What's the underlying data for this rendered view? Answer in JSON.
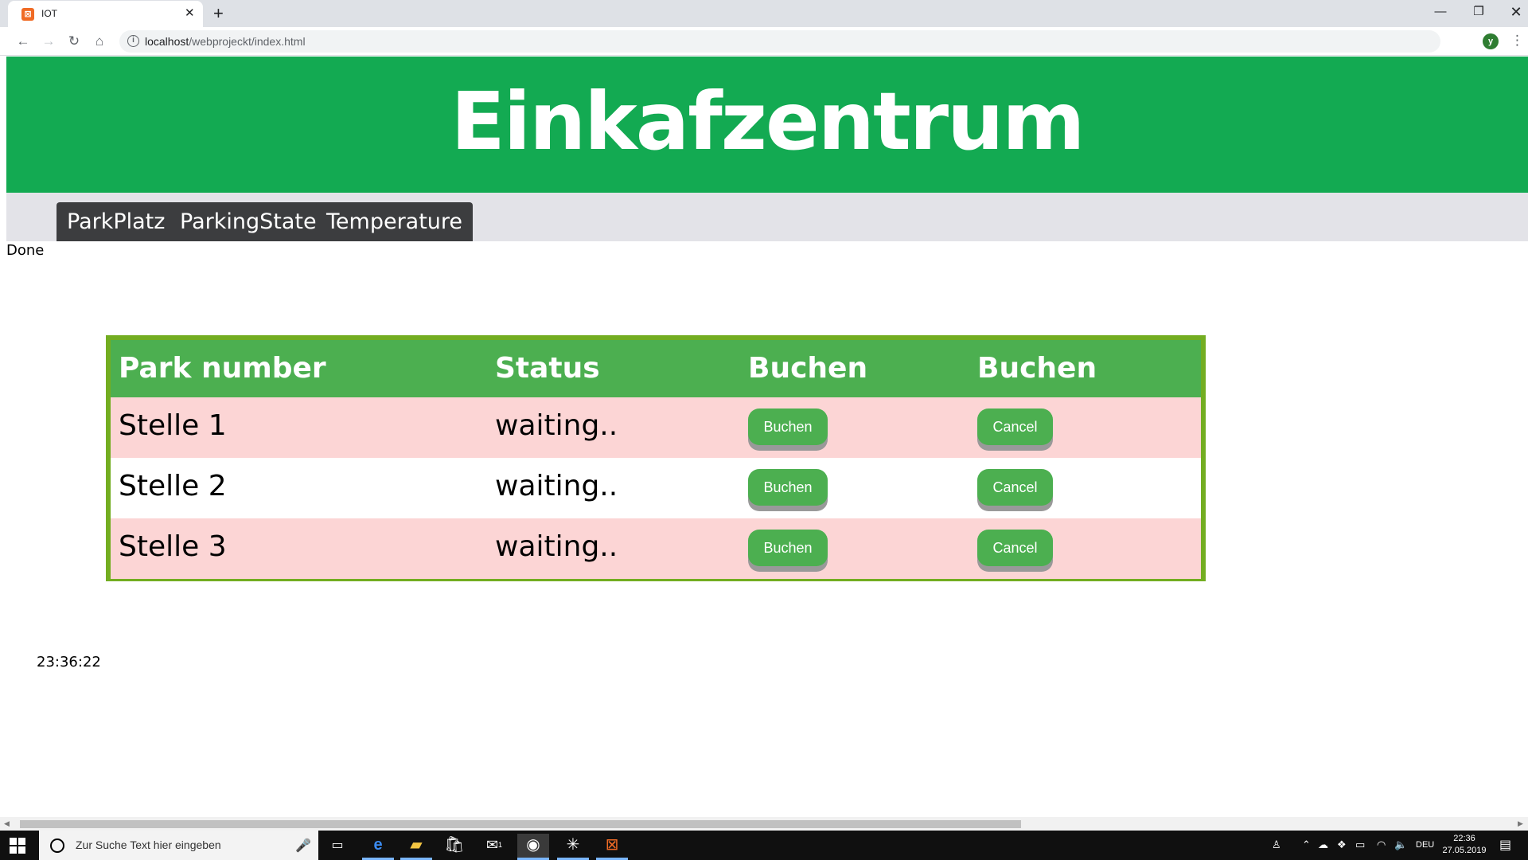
{
  "browser": {
    "tab_title": "IOT",
    "tab_close": "✕",
    "new_tab": "+",
    "url_host": "localhost",
    "url_path": "/webprojeckt/index.html",
    "profile_initial": "y",
    "window_min": "—",
    "window_max": "❐",
    "window_close": "✕"
  },
  "page": {
    "title": "Einkafzentrum",
    "nav": [
      "ParkPlatz",
      "ParkingState",
      "Temperature"
    ],
    "status_text": "Done",
    "clock": "23:36:22"
  },
  "table": {
    "headers": [
      "Park number",
      "Status",
      "Buchen",
      "Buchen"
    ],
    "rows": [
      {
        "place": "Stelle 1",
        "status": "waiting..",
        "book_label": "Buchen",
        "cancel_label": "Cancel"
      },
      {
        "place": "Stelle 2",
        "status": "waiting..",
        "book_label": "Buchen",
        "cancel_label": "Cancel"
      },
      {
        "place": "Stelle 3",
        "status": "waiting..",
        "book_label": "Buchen",
        "cancel_label": "Cancel"
      }
    ]
  },
  "taskbar": {
    "search_placeholder": "Zur Suche Text hier eingeben",
    "language": "DEU",
    "time": "22:36",
    "date": "27.05.2019",
    "mail_badge": "1"
  },
  "colors": {
    "header_green": "#13aa52",
    "table_header": "#4caf50",
    "table_border": "#73ad21",
    "row_pink": "#fcd5d5",
    "nav_dark": "#3c3d3f"
  }
}
